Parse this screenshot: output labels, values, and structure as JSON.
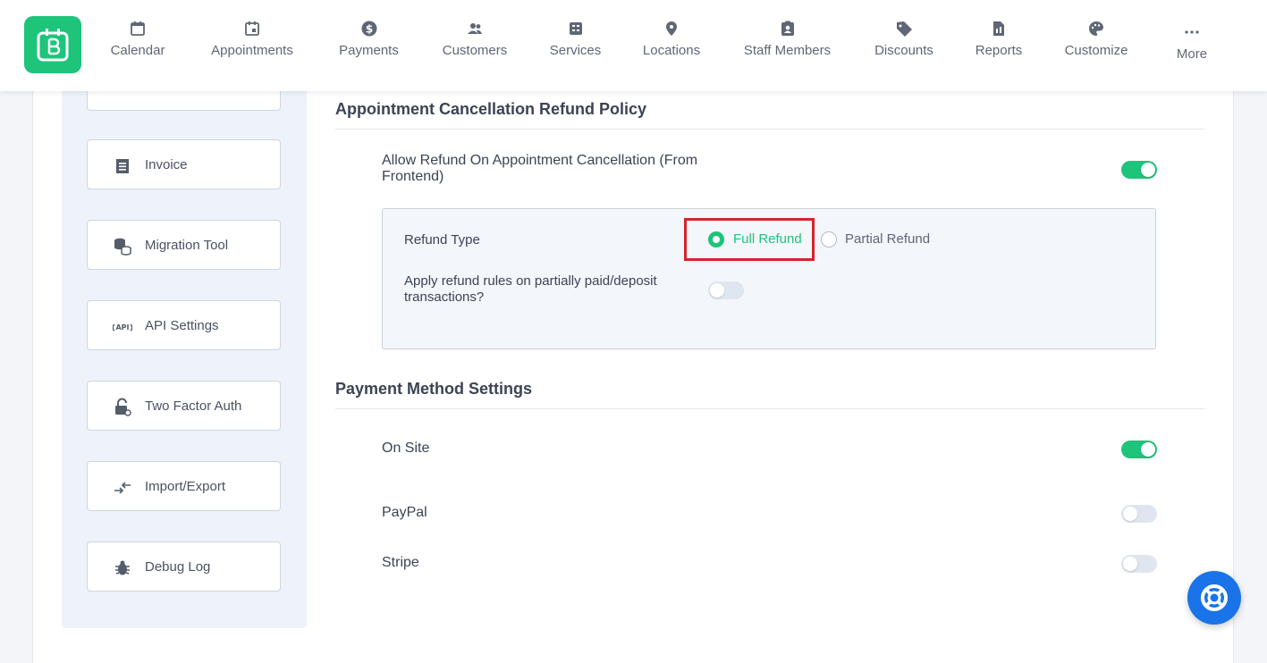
{
  "nav": {
    "items": [
      {
        "label": "Calendar",
        "icon": "calendar-icon"
      },
      {
        "label": "Appointments",
        "icon": "appointments-icon"
      },
      {
        "label": "Payments",
        "icon": "dollar-icon"
      },
      {
        "label": "Customers",
        "icon": "customers-icon"
      },
      {
        "label": "Services",
        "icon": "services-icon"
      },
      {
        "label": "Locations",
        "icon": "location-pin-icon"
      },
      {
        "label": "Staff Members",
        "icon": "staff-badge-icon"
      },
      {
        "label": "Discounts",
        "icon": "tag-icon"
      },
      {
        "label": "Reports",
        "icon": "report-icon"
      },
      {
        "label": "Customize",
        "icon": "palette-icon"
      },
      {
        "label": "More",
        "icon": "more-dots-icon"
      }
    ]
  },
  "sidebar": {
    "items": [
      {
        "label": "Invoice",
        "icon": "invoice-icon"
      },
      {
        "label": "Migration Tool",
        "icon": "database-icon"
      },
      {
        "label": "API Settings",
        "icon": "api-icon"
      },
      {
        "label": "Two Factor Auth",
        "icon": "lock-icon"
      },
      {
        "label": "Import/Export",
        "icon": "import-export-icon"
      },
      {
        "label": "Debug Log",
        "icon": "bug-icon"
      }
    ]
  },
  "refund_policy": {
    "title": "Appointment Cancellation Refund Policy",
    "allow_refund_label": "Allow Refund On Appointment Cancellation (From Frontend)",
    "allow_refund_on": true,
    "refund_type_label": "Refund Type",
    "options": {
      "full": "Full Refund",
      "partial": "Partial Refund"
    },
    "selected": "Full Refund",
    "partial_rules_label": "Apply refund rules on partially paid/deposit transactions?",
    "partial_rules_on": false
  },
  "payment_methods": {
    "title": "Payment Method Settings",
    "methods": [
      {
        "label": "On Site",
        "enabled": true
      },
      {
        "label": "PayPal",
        "enabled": false
      },
      {
        "label": "Stripe",
        "enabled": false
      }
    ]
  },
  "colors": {
    "accent": "#1ec47a",
    "highlight": "#d6232b",
    "help": "#1a73e8"
  }
}
